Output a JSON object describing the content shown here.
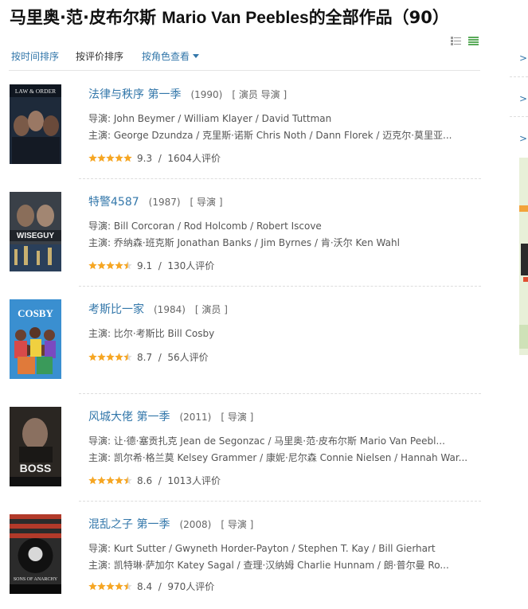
{
  "page": {
    "title_cn1": "马里奥·范·皮布尔斯 ",
    "title_en": "Mario Van Peebles",
    "title_cn2": "的全部作品（90）"
  },
  "sortbar": {
    "by_time": "按时间排序",
    "by_rating": "按评价排序",
    "by_role": "按角色查看"
  },
  "view_icons": [
    "list-view-icon",
    "grid-view-icon"
  ],
  "works": [
    {
      "title": "法律与秩序 第一季",
      "year": "(1990)",
      "role": "[ 演员 导演 ]",
      "directors": "导演: John Beymer / William Klayer / David Tuttman",
      "cast": "主演: George Dzundza / 克里斯·诺斯 Chris Noth / Dann Florek / 迈克尔·莫里亚...",
      "score": "9.3",
      "votes": "1604人评价",
      "stars": 5
    },
    {
      "title": "特警4587",
      "year": "(1987)",
      "role": "[ 导演 ]",
      "directors": "导演: Bill Corcoran / Rod Holcomb / Robert Iscove",
      "cast": "主演: 乔纳森·班克斯 Jonathan Banks / Jim Byrnes / 肯·沃尔 Ken Wahl",
      "score": "9.1",
      "votes": "130人评价",
      "stars": 4.5
    },
    {
      "title": "考斯比一家",
      "year": "(1984)",
      "role": "[ 演员 ]",
      "directors": "",
      "cast": "主演: 比尔·考斯比 Bill Cosby",
      "score": "8.7",
      "votes": "56人评价",
      "stars": 4.5
    },
    {
      "title": "风城大佬 第一季",
      "year": "(2011)",
      "role": "[ 导演 ]",
      "directors": "导演: 让·德·塞贡扎克 Jean de Segonzac / 马里奥·范·皮布尔斯 Mario Van Peebl...",
      "cast": "主演: 凯尔希·格兰莫 Kelsey Grammer / 康妮·尼尔森 Connie Nielsen / Hannah War...",
      "score": "8.6",
      "votes": "1013人评价",
      "stars": 4.5
    },
    {
      "title": "混乱之子 第一季",
      "year": "(2008)",
      "role": "[ 导演 ]",
      "directors": "导演: Kurt Sutter / Gwyneth Horder-Payton / Stephen T. Kay / Bill Gierhart",
      "cast": "主演: 凯特琳·萨加尔 Katey Sagal / 查理·汉纳姆 Charlie Hunnam / 朗·普尔曼 Ro...",
      "score": "8.4",
      "votes": "970人评价",
      "stars": 4.5
    }
  ],
  "posters": [
    {
      "caption": "LAW & ORDER",
      "bg": "#1e2a3a"
    },
    {
      "caption": "WISEGUY",
      "bg": "#3a4048"
    },
    {
      "caption": "COSBY",
      "bg": "#3a8fd0"
    },
    {
      "caption": "BOSS",
      "bg": "#2a2622"
    },
    {
      "caption": "SONS OF ANARCHY",
      "bg": "#2b2b2b"
    }
  ],
  "right_col": {
    "chevron": ">",
    "ad_colors": [
      "#e8f0d8",
      "#f2a33a"
    ]
  },
  "colors": {
    "link": "#3377aa",
    "star": "#f6a623",
    "text": "#555555"
  }
}
